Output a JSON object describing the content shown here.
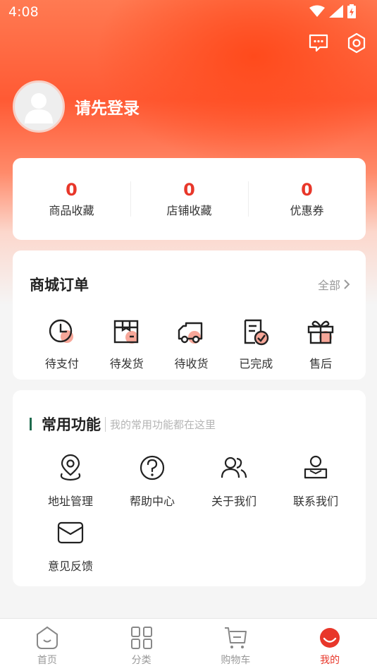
{
  "status_bar": {
    "time": "4:08"
  },
  "profile": {
    "login_text": "请先登录"
  },
  "stats": [
    {
      "value": "0",
      "label": "商品收藏"
    },
    {
      "value": "0",
      "label": "店铺收藏"
    },
    {
      "value": "0",
      "label": "优惠券"
    }
  ],
  "orders": {
    "title": "商城订单",
    "all_label": "全部",
    "items": [
      {
        "label": "待支付",
        "icon": "clock-icon"
      },
      {
        "label": "待发货",
        "icon": "package-icon"
      },
      {
        "label": "待收货",
        "icon": "truck-icon"
      },
      {
        "label": "已完成",
        "icon": "completed-icon"
      },
      {
        "label": "售后",
        "icon": "gift-icon"
      }
    ]
  },
  "functions": {
    "title": "常用功能",
    "subtitle": "我的常用功能都在这里",
    "items": [
      {
        "label": "地址管理",
        "icon": "location-icon"
      },
      {
        "label": "帮助中心",
        "icon": "help-icon"
      },
      {
        "label": "关于我们",
        "icon": "users-icon"
      },
      {
        "label": "联系我们",
        "icon": "contact-icon"
      },
      {
        "label": "意见反馈",
        "icon": "mail-icon"
      }
    ]
  },
  "tabbar": {
    "items": [
      {
        "label": "首页",
        "icon": "home-icon",
        "active": false
      },
      {
        "label": "分类",
        "icon": "category-icon",
        "active": false
      },
      {
        "label": "购物车",
        "icon": "cart-icon",
        "active": false
      },
      {
        "label": "我的",
        "icon": "profile-icon",
        "active": true
      }
    ]
  },
  "colors": {
    "accent": "#e8372a",
    "bar_accent": "#1f6b4e",
    "hero": "#ff5a34"
  }
}
